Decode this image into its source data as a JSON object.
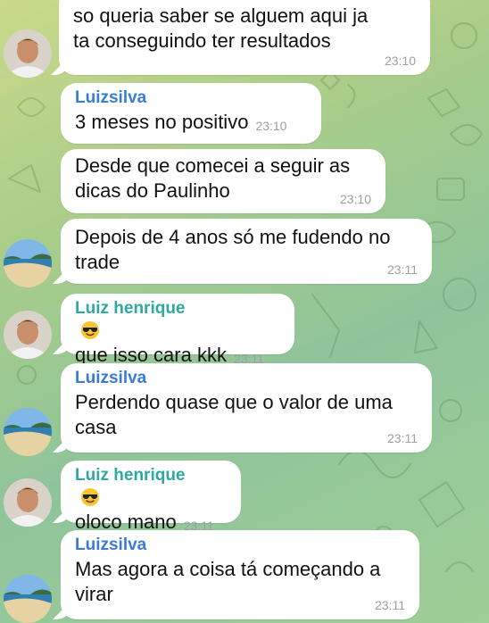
{
  "colors": {
    "bubble": "#ffffff",
    "sender_blue": "#3a7bd5",
    "sender_teal": "#2fa8a0",
    "timestamp": "#9aa0a6"
  },
  "messages": [
    {
      "text": "so queria saber se alguem aqui ja ta conseguindo ter resultados",
      "time": "23:10",
      "avatar": "avatar-man"
    },
    {
      "sender": "Luizsilva",
      "text": "3 meses no positivo",
      "time": "23:10"
    },
    {
      "text": "Desde que comecei a seguir as dicas do Paulinho",
      "time": "23:10"
    },
    {
      "text": "Depois de 4 anos só me fudendo no trade",
      "time": "23:11",
      "avatar": "avatar-beach"
    },
    {
      "sender": "Luiz henrique",
      "sender_emoji": "sunglasses-emoji",
      "text": "que isso cara kkk",
      "time": "23:11",
      "avatar": "avatar-man"
    },
    {
      "sender": "Luizsilva",
      "text": "Perdendo quase que o valor de uma casa",
      "time": "23:11",
      "avatar": "avatar-beach"
    },
    {
      "sender": "Luiz henrique",
      "sender_emoji": "sunglasses-emoji",
      "text": "oloco mano",
      "time": "23:11",
      "avatar": "avatar-man"
    },
    {
      "sender": "Luizsilva",
      "text": "Mas agora a coisa tá começando a virar",
      "time": "23:11",
      "avatar": "avatar-beach"
    }
  ]
}
